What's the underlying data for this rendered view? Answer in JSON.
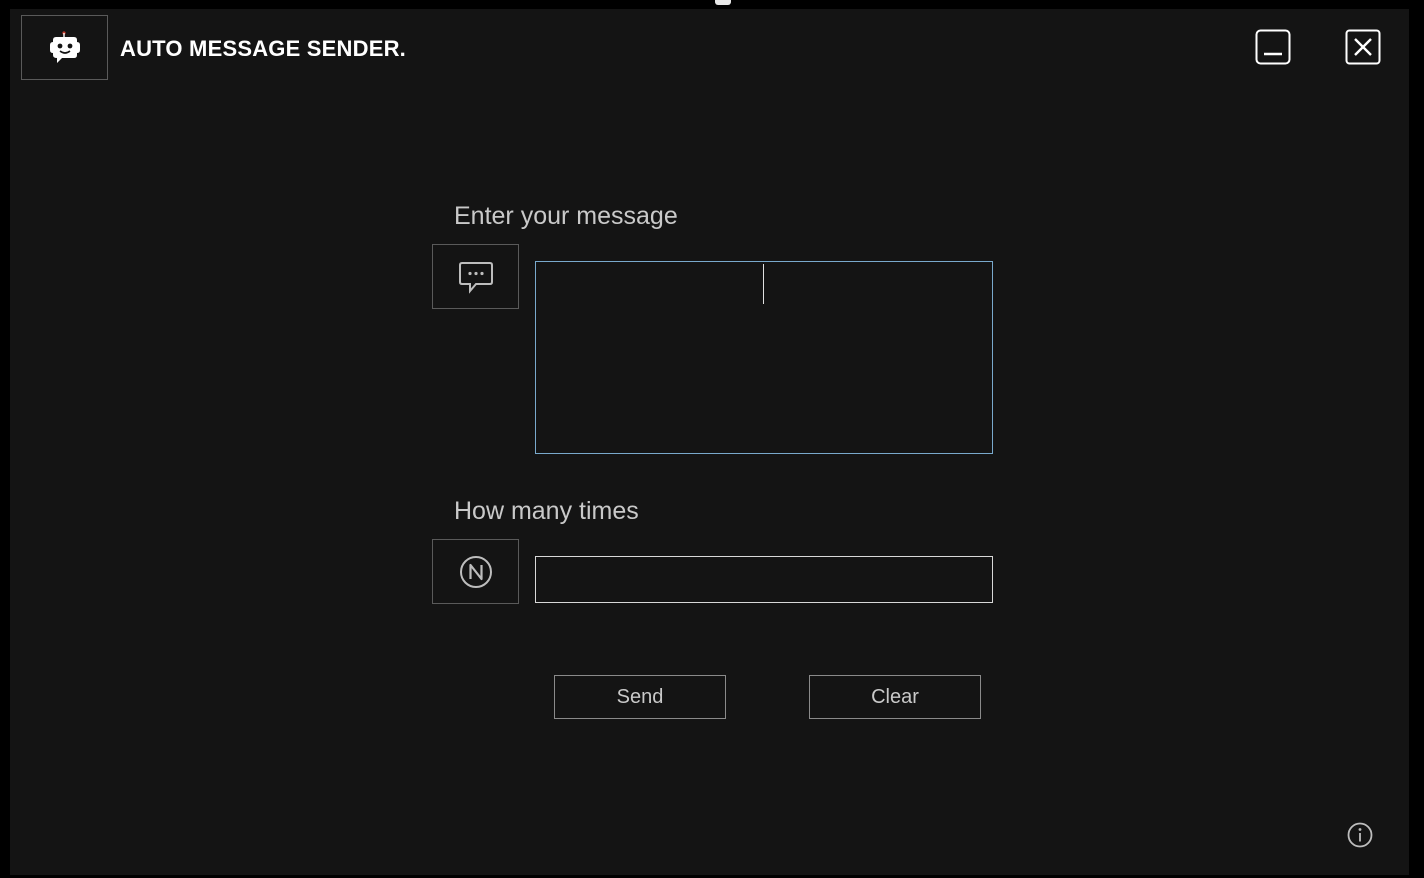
{
  "app": {
    "title": "AUTO MESSAGE SENDER.",
    "logo_icon": "robot-face-icon"
  },
  "window_controls": {
    "minimize_icon": "minimize-icon",
    "close_icon": "close-icon"
  },
  "message": {
    "label": "Enter your message",
    "icon": "chat-bubble-icon",
    "value": ""
  },
  "count": {
    "label": "How many times",
    "icon": "circled-n-icon",
    "value": ""
  },
  "actions": {
    "send_label": "Send",
    "clear_label": "Clear"
  },
  "footer": {
    "info_icon": "info-icon"
  },
  "colors": {
    "background": "#141414",
    "focus_border": "#79a9cc",
    "text": "#c9c9c9"
  }
}
